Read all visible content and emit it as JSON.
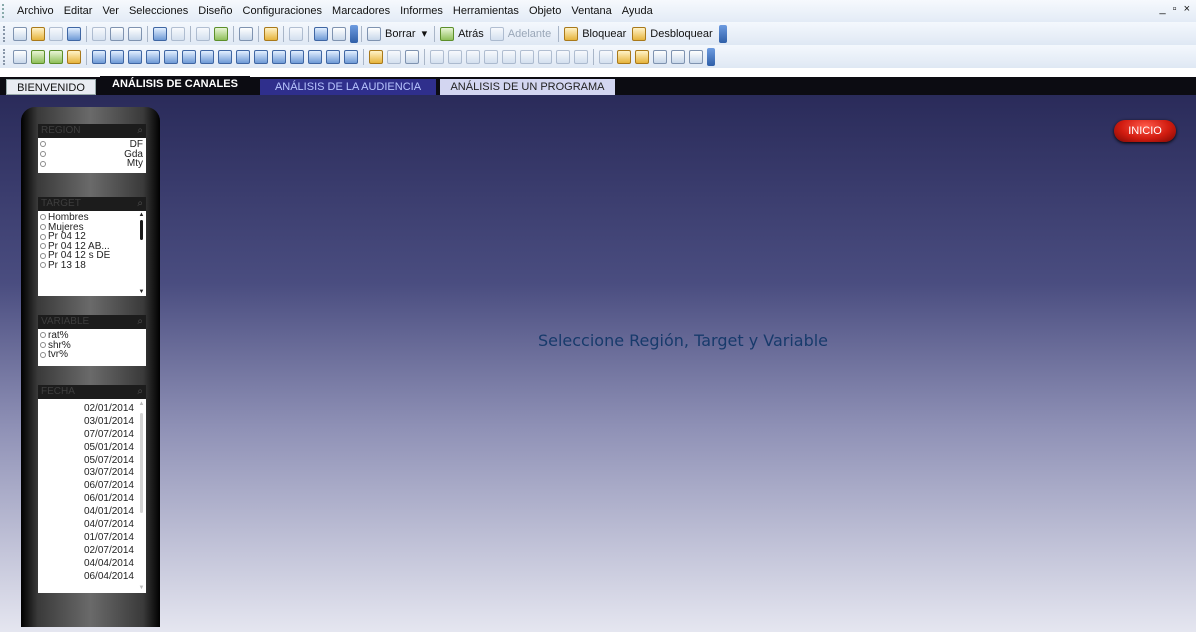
{
  "menu": [
    "Archivo",
    "Editar",
    "Ver",
    "Selecciones",
    "Diseño",
    "Configuraciones",
    "Marcadores",
    "Informes",
    "Herramientas",
    "Objeto",
    "Ventana",
    "Ayuda"
  ],
  "window_controls": "_ ▫ ×",
  "toolbar": {
    "borrar": "Borrar",
    "atras": "Atrás",
    "adelante": "Adelante",
    "bloquear": "Bloquear",
    "desbloquear": "Desbloquear"
  },
  "tabs": {
    "bienvenido": "BIENVENIDO",
    "canales": "ANÁLISIS DE CANALES",
    "audiencia": "ANÁLISIS DE LA AUDIENCIA",
    "programa": "ANÁLISIS DE UN PROGRAMA"
  },
  "filters": {
    "region": {
      "title": "REGION",
      "items": [
        "DF",
        "Gda",
        "Mty"
      ]
    },
    "target": {
      "title": "TARGET",
      "items": [
        "Hombres",
        "Mujeres",
        "Pr 04 12",
        "Pr 04 12 AB...",
        "Pr 04 12 s DE",
        "Pr 13 18"
      ]
    },
    "variable": {
      "title": "VARIABLE",
      "items": [
        "rat%",
        "shr%",
        "tvr%"
      ]
    },
    "fecha": {
      "title": "FECHA",
      "items": [
        "02/01/2014",
        "03/01/2014",
        "07/07/2014",
        "05/01/2014",
        "05/07/2014",
        "03/07/2014",
        "06/07/2014",
        "06/01/2014",
        "04/01/2014",
        "04/07/2014",
        "01/07/2014",
        "02/07/2014",
        "04/04/2014",
        "06/04/2014"
      ]
    }
  },
  "main": {
    "prompt": "Seleccione Región, Target y Variable",
    "inicio": "INICIO"
  },
  "colors": {
    "accent_red": "#d21c10",
    "prompt_text": "#173a6b",
    "active_tab": "#0c0c12"
  }
}
